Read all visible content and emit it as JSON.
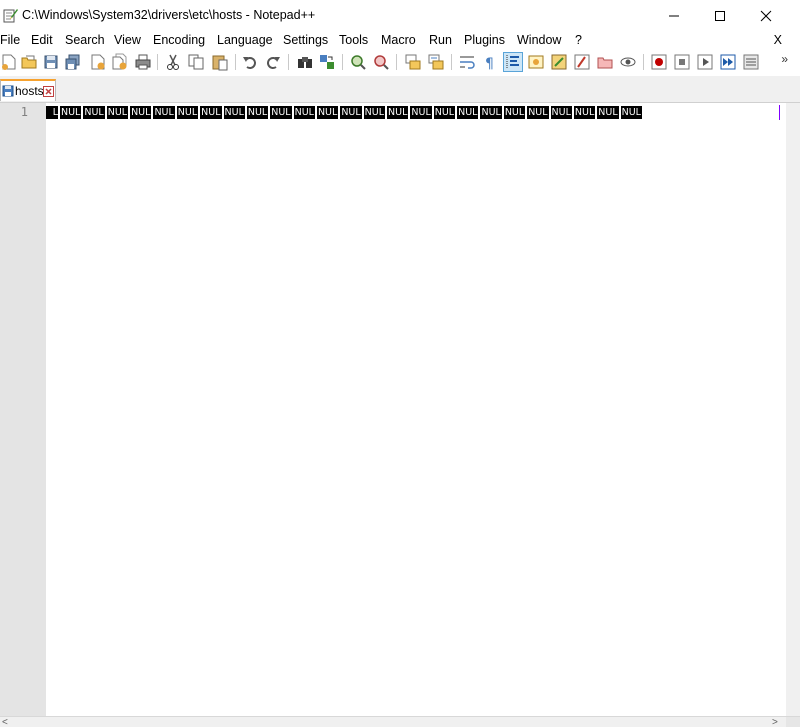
{
  "window": {
    "title": "C:\\Windows\\System32\\drivers\\etc\\hosts - Notepad++",
    "minimize_icon": "minimize-icon",
    "maximize_icon": "maximize-icon",
    "close_icon": "close-icon"
  },
  "menu": {
    "items": [
      "File",
      "Edit",
      "Search",
      "View",
      "Encoding",
      "Language",
      "Settings",
      "Tools",
      "Macro",
      "Run",
      "Plugins",
      "Window",
      "?"
    ],
    "close_label": "X"
  },
  "toolbar": {
    "buttons": [
      "new-file-icon",
      "open-file-icon",
      "save-icon",
      "save-all-icon",
      "close-icon",
      "close-all-icon",
      "print-icon",
      "cut-icon",
      "copy-icon",
      "paste-icon",
      "undo-icon",
      "redo-icon",
      "find-icon",
      "replace-icon",
      "zoom-in-icon",
      "zoom-out-icon",
      "sync-vertical-icon",
      "sync-horizontal-icon",
      "word-wrap-icon",
      "show-all-characters-icon",
      "indent-guide-icon",
      "user-language-icon",
      "document-map-icon",
      "function-list-icon",
      "folder-as-workspace-icon",
      "monitoring-icon",
      "record-macro-icon",
      "stop-recording-icon",
      "play-macro-icon",
      "run-macro-multiple-icon",
      "save-macro-icon"
    ],
    "more_label": "»"
  },
  "tabs": [
    {
      "label": "hosts",
      "active": true
    }
  ],
  "editor": {
    "line_number": "1",
    "first_token": "L",
    "nul_token": "NUL",
    "nul_count": 25,
    "caret_color": "#8000ff"
  },
  "colors": {
    "tab_accent": "#f7a22e",
    "gutter": "#e4e4e4",
    "nul_background": "#000000",
    "nul_text": "#ffffff"
  }
}
